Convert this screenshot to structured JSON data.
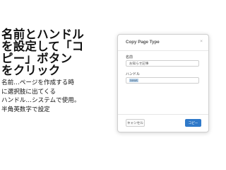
{
  "headline": {
    "lines": [
      "名前とハンドル",
      "を設定して「コ",
      "ピー」ボタン",
      "をクリック"
    ]
  },
  "notes": {
    "lines": [
      "名前…ページを作成する時",
      "に選択肢に出てくる",
      "ハンドル…システムで使用。",
      "半角英数字で設定"
    ]
  },
  "dialog": {
    "title": "Copy Page Type",
    "close_icon": "×",
    "name_label": "名前",
    "name_value": "お知らせ記事",
    "handle_label": "ハンドル",
    "handle_value": "news",
    "cancel_label": "キャンセル",
    "copy_label": "コピー"
  }
}
